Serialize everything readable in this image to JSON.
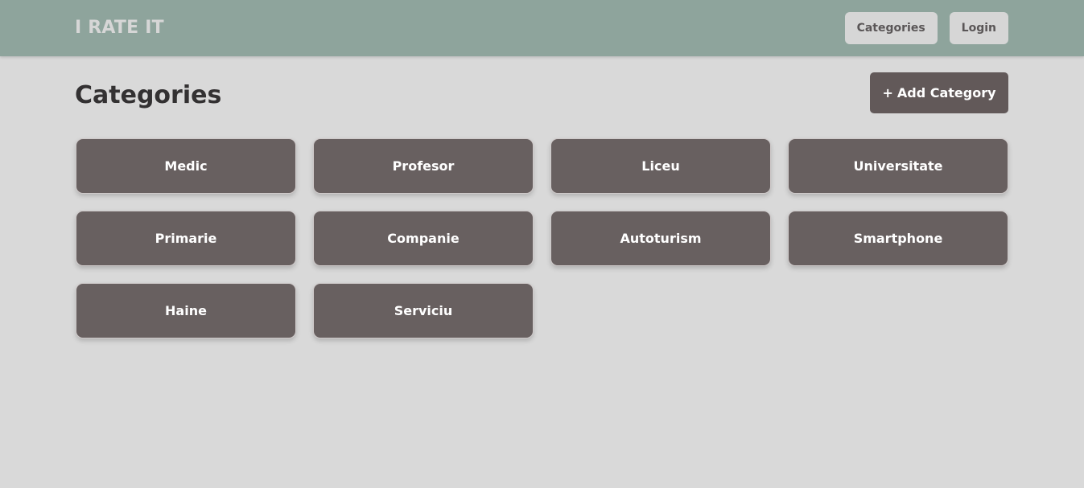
{
  "navbar": {
    "brand": "I RATE IT",
    "links": [
      {
        "label": "Categories"
      },
      {
        "label": "Login"
      }
    ]
  },
  "main": {
    "title": "Categories",
    "add_button": {
      "icon": "+",
      "label": "Add Category"
    },
    "categories": [
      {
        "label": "Medic"
      },
      {
        "label": "Profesor"
      },
      {
        "label": "Liceu"
      },
      {
        "label": "Universitate"
      },
      {
        "label": "Primarie"
      },
      {
        "label": "Companie"
      },
      {
        "label": "Autoturism"
      },
      {
        "label": "Smartphone"
      },
      {
        "label": "Haine"
      },
      {
        "label": "Serviciu"
      }
    ]
  },
  "colors": {
    "navbar_bg": "#8ea49c",
    "page_bg": "#d9d9d9",
    "card_bg": "#686060",
    "button_dark": "#625959",
    "nav_button_bg": "#d6d6d6"
  }
}
